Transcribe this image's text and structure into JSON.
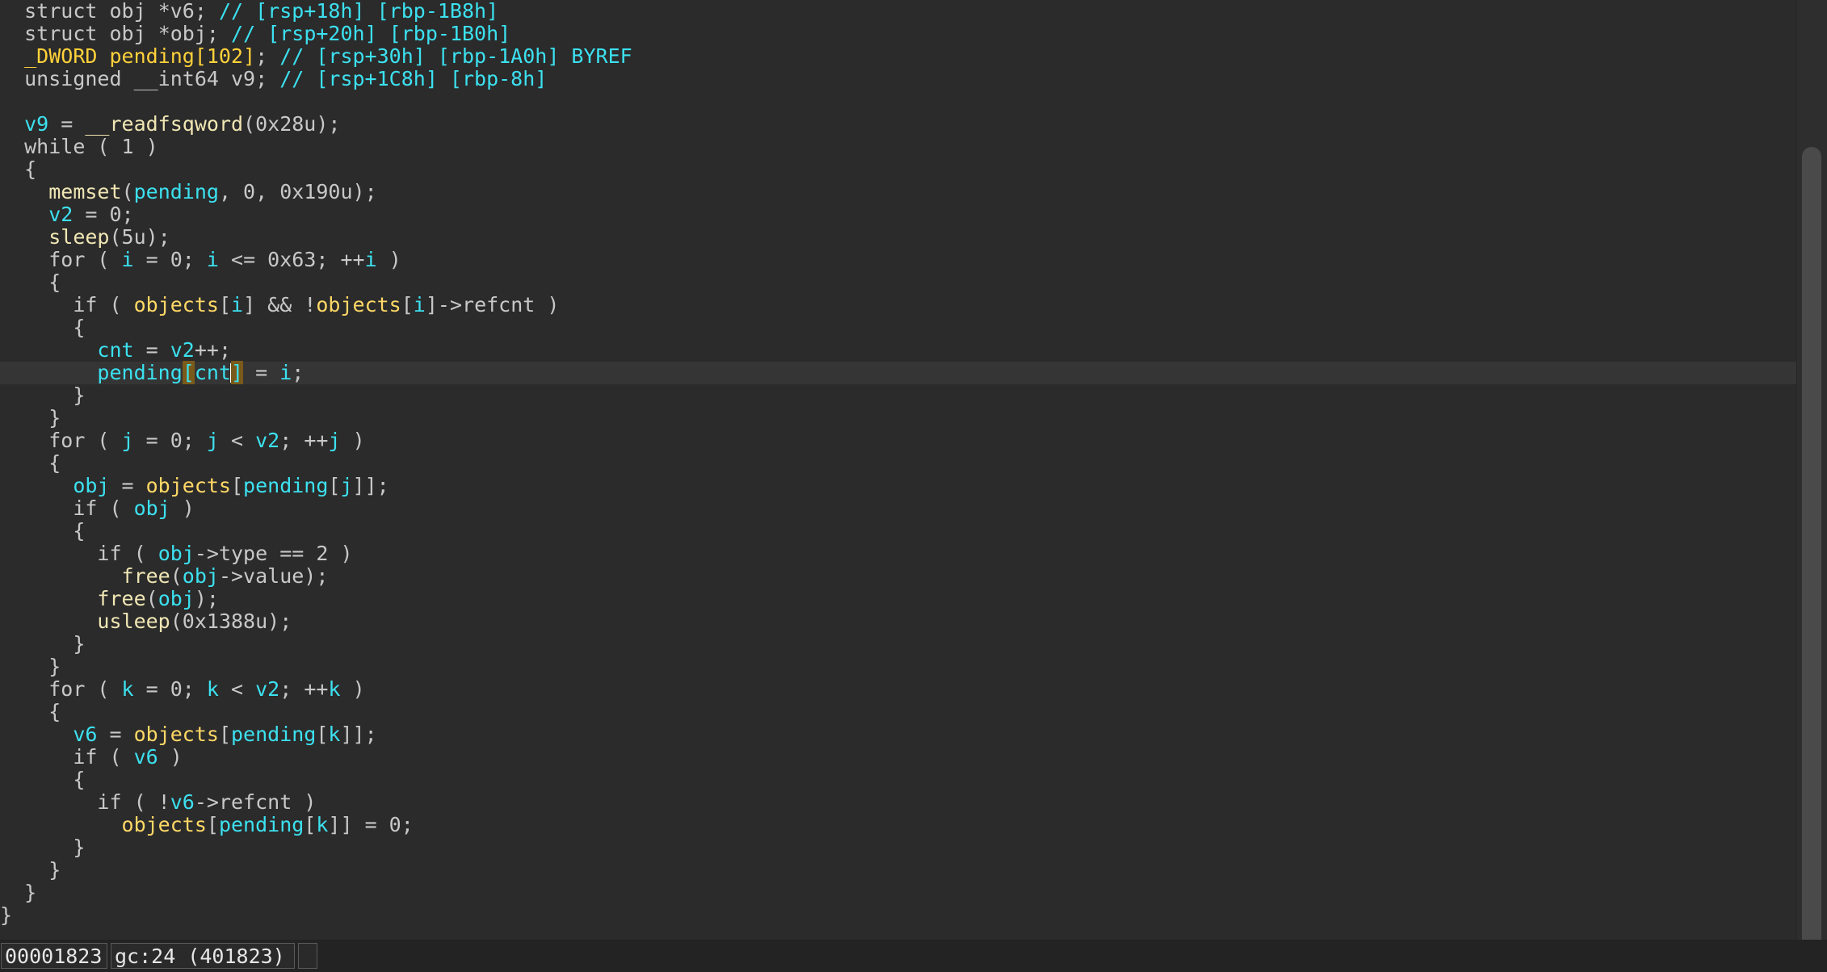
{
  "code_lines": [
    {
      "indent": "  ",
      "tokens": [
        {
          "t": "struct obj ",
          "c": "kw"
        },
        {
          "t": "*v6",
          "c": "kw"
        },
        {
          "t": "; ",
          "c": "pn"
        },
        {
          "t": "// [rsp+18h] [rbp-1B8h]",
          "c": "cm"
        }
      ]
    },
    {
      "indent": "  ",
      "tokens": [
        {
          "t": "struct obj ",
          "c": "kw"
        },
        {
          "t": "*obj",
          "c": "kw"
        },
        {
          "t": "; ",
          "c": "pn"
        },
        {
          "t": "// [rsp+20h] [rbp-1B0h]",
          "c": "cm"
        }
      ]
    },
    {
      "indent": "  ",
      "tokens": [
        {
          "t": "_DWORD ",
          "c": "typ"
        },
        {
          "t": "pending[102]",
          "c": "typ"
        },
        {
          "t": "; ",
          "c": "pn"
        },
        {
          "t": "// [rsp+30h] [rbp-1A0h] BYREF",
          "c": "cm"
        }
      ]
    },
    {
      "indent": "  ",
      "tokens": [
        {
          "t": "unsigned __int64 ",
          "c": "kw"
        },
        {
          "t": "v9",
          "c": "kw"
        },
        {
          "t": "; ",
          "c": "pn"
        },
        {
          "t": "// [rsp+1C8h] [rbp-8h]",
          "c": "cm"
        }
      ]
    },
    {
      "indent": "",
      "tokens": []
    },
    {
      "indent": "  ",
      "tokens": [
        {
          "t": "v9",
          "c": "var"
        },
        {
          "t": " = ",
          "c": "pn"
        },
        {
          "t": "__readfsqword",
          "c": "fn"
        },
        {
          "t": "(0x28u);",
          "c": "pn"
        }
      ]
    },
    {
      "indent": "  ",
      "tokens": [
        {
          "t": "while",
          "c": "kw"
        },
        {
          "t": " ( 1 )",
          "c": "pn"
        }
      ]
    },
    {
      "indent": "  ",
      "tokens": [
        {
          "t": "{",
          "c": "pn"
        }
      ]
    },
    {
      "indent": "    ",
      "tokens": [
        {
          "t": "memset",
          "c": "fn"
        },
        {
          "t": "(",
          "c": "pn"
        },
        {
          "t": "pending",
          "c": "var"
        },
        {
          "t": ", 0, 0x190u);",
          "c": "pn"
        }
      ]
    },
    {
      "indent": "    ",
      "tokens": [
        {
          "t": "v2",
          "c": "var"
        },
        {
          "t": " = 0;",
          "c": "pn"
        }
      ]
    },
    {
      "indent": "    ",
      "tokens": [
        {
          "t": "sleep",
          "c": "fn"
        },
        {
          "t": "(5u);",
          "c": "pn"
        }
      ]
    },
    {
      "indent": "    ",
      "tokens": [
        {
          "t": "for",
          "c": "kw"
        },
        {
          "t": " ( ",
          "c": "pn"
        },
        {
          "t": "i",
          "c": "var"
        },
        {
          "t": " = 0; ",
          "c": "pn"
        },
        {
          "t": "i",
          "c": "var"
        },
        {
          "t": " <= 0x63; ++",
          "c": "pn"
        },
        {
          "t": "i",
          "c": "var"
        },
        {
          "t": " )",
          "c": "pn"
        }
      ]
    },
    {
      "indent": "    ",
      "tokens": [
        {
          "t": "{",
          "c": "pn"
        }
      ]
    },
    {
      "indent": "      ",
      "tokens": [
        {
          "t": "if",
          "c": "kw"
        },
        {
          "t": " ( ",
          "c": "pn"
        },
        {
          "t": "objects",
          "c": "gl"
        },
        {
          "t": "[",
          "c": "pn"
        },
        {
          "t": "i",
          "c": "var"
        },
        {
          "t": "] && !",
          "c": "pn"
        },
        {
          "t": "objects",
          "c": "gl"
        },
        {
          "t": "[",
          "c": "pn"
        },
        {
          "t": "i",
          "c": "var"
        },
        {
          "t": "]->refcnt )",
          "c": "pn"
        }
      ]
    },
    {
      "indent": "      ",
      "tokens": [
        {
          "t": "{",
          "c": "pn"
        }
      ]
    },
    {
      "indent": "        ",
      "tokens": [
        {
          "t": "cnt",
          "c": "var"
        },
        {
          "t": " = ",
          "c": "pn"
        },
        {
          "t": "v2",
          "c": "var"
        },
        {
          "t": "++;",
          "c": "pn"
        }
      ]
    },
    {
      "indent": "        ",
      "current": true,
      "tokens": [
        {
          "t": "pending",
          "c": "var"
        },
        {
          "t": "[",
          "c": "hl"
        },
        {
          "t": "cnt",
          "c": "var"
        },
        {
          "t": "",
          "c": "cursor"
        },
        {
          "t": "]",
          "c": "hl"
        },
        {
          "t": " = ",
          "c": "pn"
        },
        {
          "t": "i",
          "c": "var"
        },
        {
          "t": ";",
          "c": "pn"
        }
      ]
    },
    {
      "indent": "      ",
      "tokens": [
        {
          "t": "}",
          "c": "pn"
        }
      ]
    },
    {
      "indent": "    ",
      "tokens": [
        {
          "t": "}",
          "c": "pn"
        }
      ]
    },
    {
      "indent": "    ",
      "tokens": [
        {
          "t": "for",
          "c": "kw"
        },
        {
          "t": " ( ",
          "c": "pn"
        },
        {
          "t": "j",
          "c": "var"
        },
        {
          "t": " = 0; ",
          "c": "pn"
        },
        {
          "t": "j",
          "c": "var"
        },
        {
          "t": " < ",
          "c": "pn"
        },
        {
          "t": "v2",
          "c": "var"
        },
        {
          "t": "; ++",
          "c": "pn"
        },
        {
          "t": "j",
          "c": "var"
        },
        {
          "t": " )",
          "c": "pn"
        }
      ]
    },
    {
      "indent": "    ",
      "tokens": [
        {
          "t": "{",
          "c": "pn"
        }
      ]
    },
    {
      "indent": "      ",
      "tokens": [
        {
          "t": "obj",
          "c": "var"
        },
        {
          "t": " = ",
          "c": "pn"
        },
        {
          "t": "objects",
          "c": "gl"
        },
        {
          "t": "[",
          "c": "pn"
        },
        {
          "t": "pending",
          "c": "var"
        },
        {
          "t": "[",
          "c": "pn"
        },
        {
          "t": "j",
          "c": "var"
        },
        {
          "t": "]];",
          "c": "pn"
        }
      ]
    },
    {
      "indent": "      ",
      "tokens": [
        {
          "t": "if",
          "c": "kw"
        },
        {
          "t": " ( ",
          "c": "pn"
        },
        {
          "t": "obj",
          "c": "var"
        },
        {
          "t": " )",
          "c": "pn"
        }
      ]
    },
    {
      "indent": "      ",
      "tokens": [
        {
          "t": "{",
          "c": "pn"
        }
      ]
    },
    {
      "indent": "        ",
      "tokens": [
        {
          "t": "if",
          "c": "kw"
        },
        {
          "t": " ( ",
          "c": "pn"
        },
        {
          "t": "obj",
          "c": "var"
        },
        {
          "t": "->type == 2 )",
          "c": "pn"
        }
      ]
    },
    {
      "indent": "          ",
      "tokens": [
        {
          "t": "free",
          "c": "fn"
        },
        {
          "t": "(",
          "c": "pn"
        },
        {
          "t": "obj",
          "c": "var"
        },
        {
          "t": "->value);",
          "c": "pn"
        }
      ]
    },
    {
      "indent": "        ",
      "tokens": [
        {
          "t": "free",
          "c": "fn"
        },
        {
          "t": "(",
          "c": "pn"
        },
        {
          "t": "obj",
          "c": "var"
        },
        {
          "t": ");",
          "c": "pn"
        }
      ]
    },
    {
      "indent": "        ",
      "tokens": [
        {
          "t": "usleep",
          "c": "fn"
        },
        {
          "t": "(0x1388u);",
          "c": "pn"
        }
      ]
    },
    {
      "indent": "      ",
      "tokens": [
        {
          "t": "}",
          "c": "pn"
        }
      ]
    },
    {
      "indent": "    ",
      "tokens": [
        {
          "t": "}",
          "c": "pn"
        }
      ]
    },
    {
      "indent": "    ",
      "tokens": [
        {
          "t": "for",
          "c": "kw"
        },
        {
          "t": " ( ",
          "c": "pn"
        },
        {
          "t": "k",
          "c": "var"
        },
        {
          "t": " = 0; ",
          "c": "pn"
        },
        {
          "t": "k",
          "c": "var"
        },
        {
          "t": " < ",
          "c": "pn"
        },
        {
          "t": "v2",
          "c": "var"
        },
        {
          "t": "; ++",
          "c": "pn"
        },
        {
          "t": "k",
          "c": "var"
        },
        {
          "t": " )",
          "c": "pn"
        }
      ]
    },
    {
      "indent": "    ",
      "tokens": [
        {
          "t": "{",
          "c": "pn"
        }
      ]
    },
    {
      "indent": "      ",
      "tokens": [
        {
          "t": "v6",
          "c": "var"
        },
        {
          "t": " = ",
          "c": "pn"
        },
        {
          "t": "objects",
          "c": "gl"
        },
        {
          "t": "[",
          "c": "pn"
        },
        {
          "t": "pending",
          "c": "var"
        },
        {
          "t": "[",
          "c": "pn"
        },
        {
          "t": "k",
          "c": "var"
        },
        {
          "t": "]];",
          "c": "pn"
        }
      ]
    },
    {
      "indent": "      ",
      "tokens": [
        {
          "t": "if",
          "c": "kw"
        },
        {
          "t": " ( ",
          "c": "pn"
        },
        {
          "t": "v6",
          "c": "var"
        },
        {
          "t": " )",
          "c": "pn"
        }
      ]
    },
    {
      "indent": "      ",
      "tokens": [
        {
          "t": "{",
          "c": "pn"
        }
      ]
    },
    {
      "indent": "        ",
      "tokens": [
        {
          "t": "if",
          "c": "kw"
        },
        {
          "t": " ( !",
          "c": "pn"
        },
        {
          "t": "v6",
          "c": "var"
        },
        {
          "t": "->refcnt )",
          "c": "pn"
        }
      ]
    },
    {
      "indent": "          ",
      "tokens": [
        {
          "t": "objects",
          "c": "gl"
        },
        {
          "t": "[",
          "c": "pn"
        },
        {
          "t": "pending",
          "c": "var"
        },
        {
          "t": "[",
          "c": "pn"
        },
        {
          "t": "k",
          "c": "var"
        },
        {
          "t": "]] = 0;",
          "c": "pn"
        }
      ]
    },
    {
      "indent": "      ",
      "tokens": [
        {
          "t": "}",
          "c": "pn"
        }
      ]
    },
    {
      "indent": "    ",
      "tokens": [
        {
          "t": "}",
          "c": "pn"
        }
      ]
    },
    {
      "indent": "  ",
      "tokens": [
        {
          "t": "}",
          "c": "pn"
        }
      ]
    },
    {
      "indent": "",
      "tokens": [
        {
          "t": "}",
          "c": "pn"
        }
      ]
    }
  ],
  "status": {
    "address": "00001823",
    "location": "gc:24 (401823)",
    "extra": ""
  },
  "colors": {
    "background": "#2b2b2b",
    "identifier": "#3ce1f0",
    "function": "#f0e6b4",
    "type_highlight": "#ffd13a",
    "keyword": "#c8c8c8"
  }
}
